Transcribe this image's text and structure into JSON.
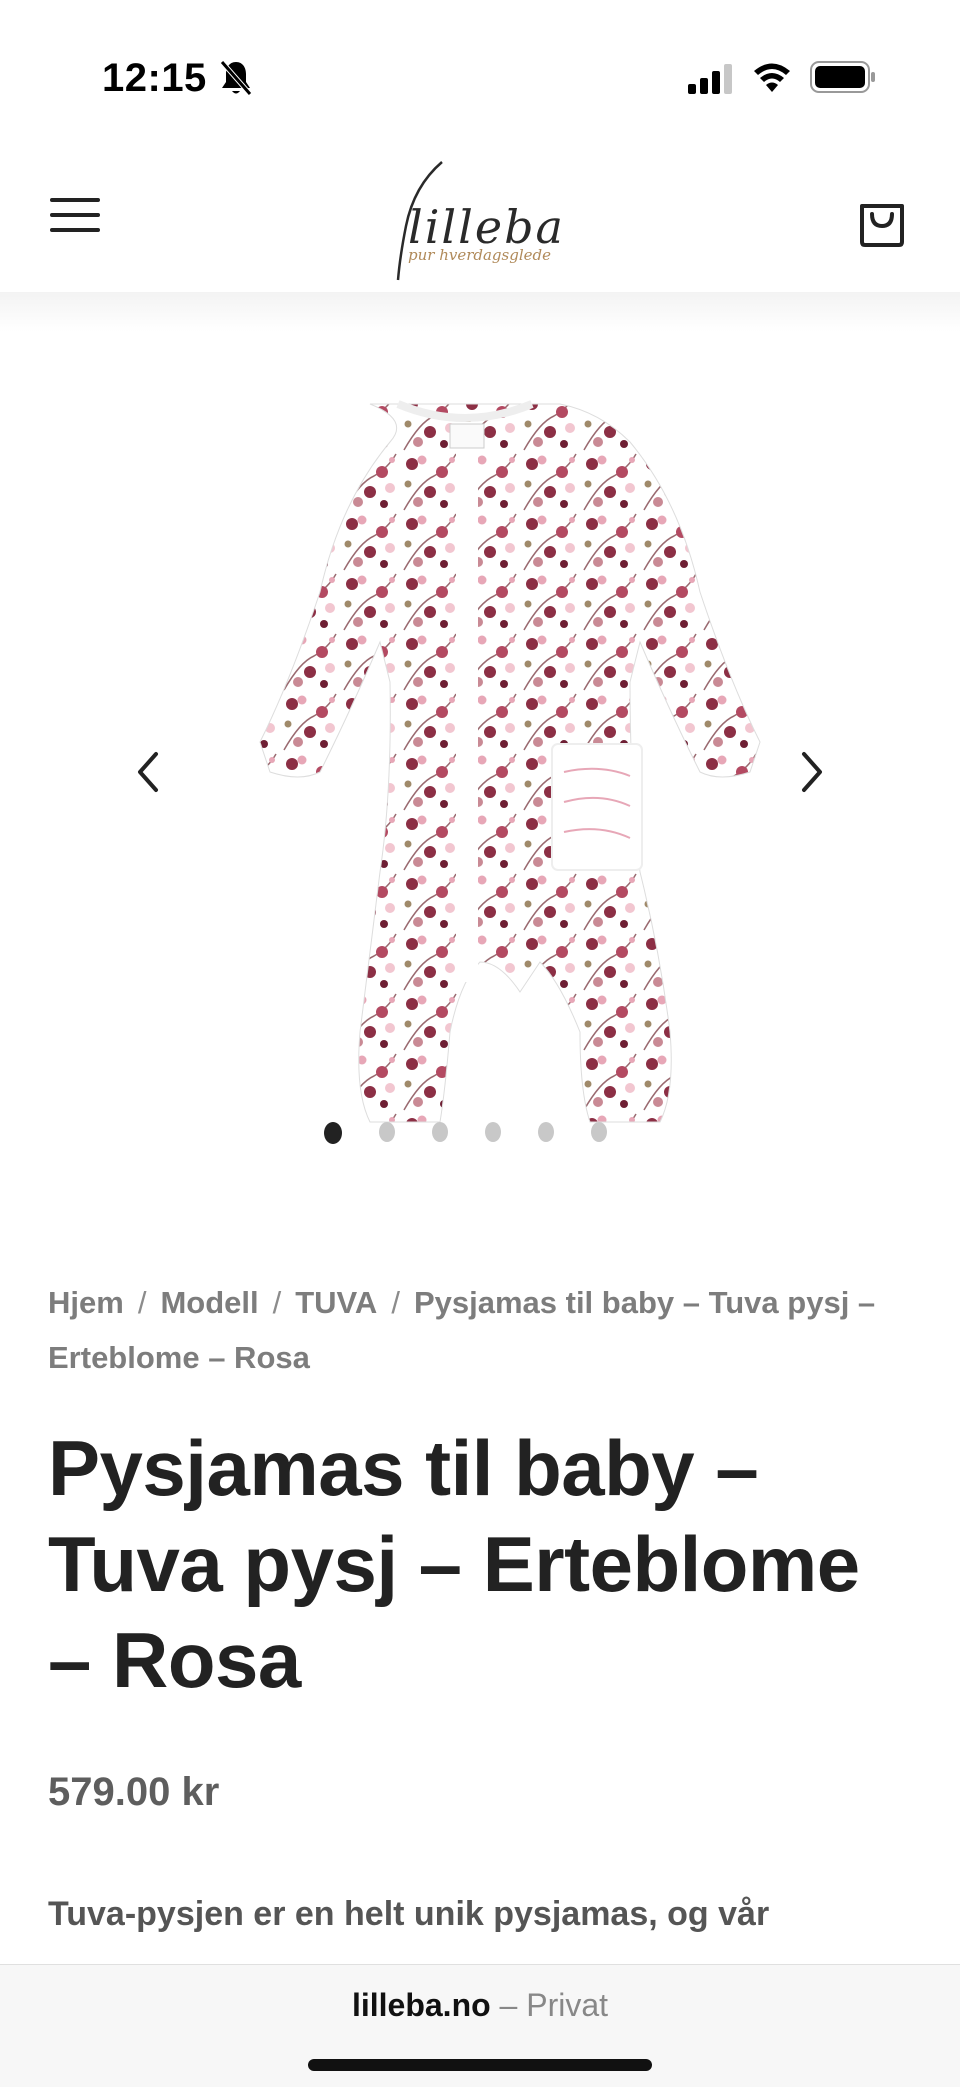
{
  "status_bar": {
    "time": "12:15",
    "icons": [
      "bell-slash-icon",
      "signal-icon",
      "wifi-icon",
      "battery-icon"
    ]
  },
  "header": {
    "logo_text": "lilleba",
    "logo_tagline": "pur hverdagsglede",
    "icons": [
      "menu-icon",
      "cart-icon"
    ]
  },
  "gallery": {
    "image_alt": "Tuva pysj Erteblome Rosa",
    "image_count": 6,
    "active_index": 0
  },
  "breadcrumb": {
    "items": [
      "Hjem",
      "Modell",
      "TUVA",
      "Pysjamas til baby – Tuva pysj – Erteblome – Rosa"
    ],
    "separator": "/"
  },
  "product": {
    "title": "Pysjamas til baby – Tuva pysj – Erteblome – Rosa",
    "price": "579.00 kr",
    "description": "Tuva-pysjen er en helt unik pysjamas, og vår"
  },
  "browser": {
    "domain": "lilleba.no",
    "separator": "–",
    "mode": "Privat"
  },
  "colors": {
    "text_dark": "#222222",
    "text_muted": "#7d7d7d",
    "print_burgundy": "#8c2f45",
    "print_pink": "#e7a7b7",
    "logo_gold": "#b08a5a"
  }
}
